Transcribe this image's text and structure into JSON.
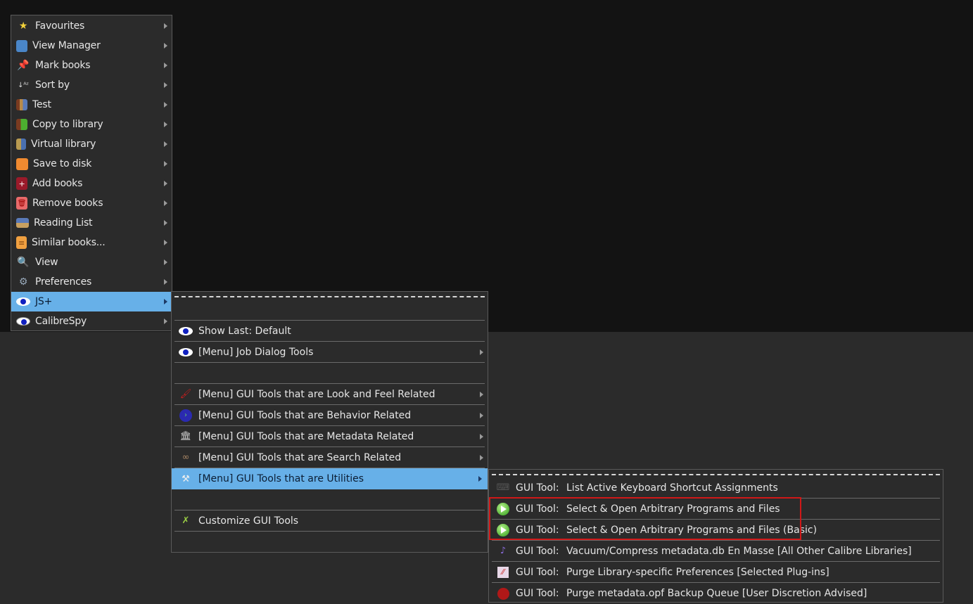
{
  "main_menu": {
    "items": [
      {
        "label": "Favourites",
        "icon": "star-icon"
      },
      {
        "label": "View Manager",
        "icon": "view-manager-icon"
      },
      {
        "label": "Mark books",
        "icon": "pin-icon"
      },
      {
        "label": "Sort by",
        "icon": "sort-az-icon"
      },
      {
        "label": "Test",
        "icon": "library-icon"
      },
      {
        "label": "Copy to library",
        "icon": "copy-library-icon"
      },
      {
        "label": "Virtual library",
        "icon": "virtual-library-icon"
      },
      {
        "label": "Save to disk",
        "icon": "save-icon"
      },
      {
        "label": "Add books",
        "icon": "add-book-icon"
      },
      {
        "label": "Remove books",
        "icon": "trash-icon"
      },
      {
        "label": "Reading List",
        "icon": "books-stack-icon"
      },
      {
        "label": "Similar books...",
        "icon": "similar-books-icon"
      },
      {
        "label": "View",
        "icon": "magnifier-icon"
      },
      {
        "label": "Preferences",
        "icon": "gears-icon"
      },
      {
        "label": "JS+",
        "icon": "eye-icon",
        "highlighted": true
      },
      {
        "label": "CalibreSpy",
        "icon": "spy-eye-icon"
      }
    ]
  },
  "jsplus_menu": {
    "items": [
      {
        "label": "Show Last: Default",
        "icon": "eye-icon"
      },
      {
        "label": "[Menu] Job Dialog Tools",
        "icon": "eye-icon"
      },
      {
        "label": "[Menu] GUI Tools that are Look and Feel Related",
        "icon": "paintbrush-icon"
      },
      {
        "label": "[Menu] GUI Tools that are Behavior Related",
        "icon": "behavior-icon"
      },
      {
        "label": "[Menu] GUI Tools that are Metadata Related",
        "icon": "column-icon"
      },
      {
        "label": "[Menu] GUI Tools that are Search Related",
        "icon": "binoculars-icon"
      },
      {
        "label": "[Menu] GUI Tools that are Utilities",
        "icon": "tools-icon",
        "highlighted": true
      },
      {
        "label": "Customize GUI Tools",
        "icon": "customize-icon"
      }
    ]
  },
  "utilities_menu": {
    "prefix": "GUI Tool:",
    "items": [
      {
        "label": "List Active Keyboard Shortcut Assignments",
        "icon": "keyboard-icon"
      },
      {
        "label": "Select & Open Arbitrary Programs and Files",
        "icon": "play-icon"
      },
      {
        "label": "Select & Open Arbitrary Programs and Files (Basic)",
        "icon": "play-icon"
      },
      {
        "label": "Vacuum/Compress metadata.db En Masse [All Other Calibre Libraries]",
        "icon": "vacuum-icon"
      },
      {
        "label": "Purge Library-specific Preferences [Selected Plug-ins]",
        "icon": "purge-icon"
      },
      {
        "label": "Purge metadata.opf Backup Queue [User Discretion Advised]",
        "icon": "stop-icon"
      }
    ]
  },
  "colors": {
    "highlight": "#67b0e8",
    "annotation_box": "#d01818"
  }
}
